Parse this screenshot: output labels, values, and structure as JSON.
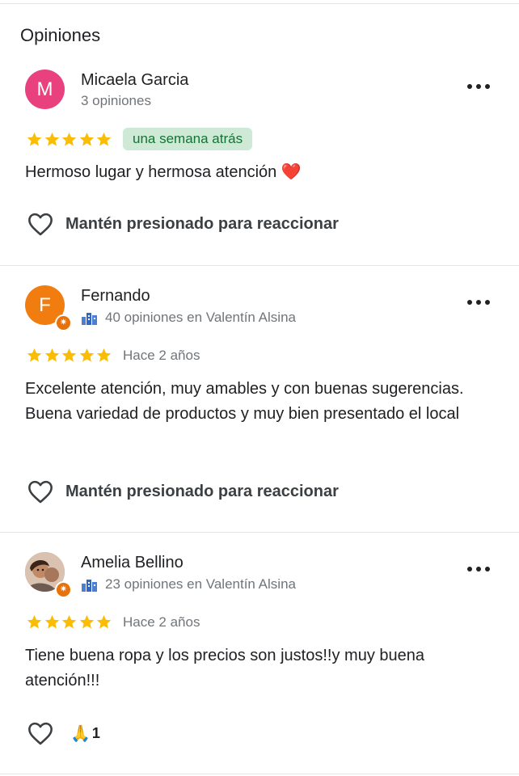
{
  "section_title": "Opiniones",
  "reviews": [
    {
      "avatar_letter": "M",
      "avatar_color": "#e8417e",
      "name": "Micaela Garcia",
      "meta": "3 opiniones",
      "stars": 5,
      "date": "una semana atrás",
      "text": "Hermoso lugar y hermosa atención",
      "text_emoji": "❤️",
      "reaction_label": "Mantén presionado para reaccionar"
    },
    {
      "avatar_letter": "F",
      "avatar_color": "#f17c0f",
      "name": "Fernando",
      "meta": "40 opiniones en Valentín Alsina",
      "stars": 5,
      "date": "Hace 2 años",
      "text": "Excelente atención, muy amables y con buenas sugerencias. Buena variedad de productos y muy bien presentado el local",
      "reaction_label": "Mantén presionado para reaccionar"
    },
    {
      "avatar_letter": "",
      "avatar_color": "#b48a6c",
      "name": "Amelia Bellino",
      "meta": "23 opiniones en Valentín Alsina",
      "stars": 5,
      "date": "Hace 2 años",
      "text": "Tiene buena ropa y los precios son justos!!y muy buena atención!!!",
      "reaction_emoji": "🙏",
      "reaction_count": "1"
    }
  ],
  "colors": {
    "star": "#fbbc04",
    "local_guide_badge": "#e8710a"
  },
  "icons": {
    "more": "more-options-icon",
    "heart": "heart-outline-icon",
    "city": "city-icon",
    "badge": "local-guide-badge-icon"
  }
}
